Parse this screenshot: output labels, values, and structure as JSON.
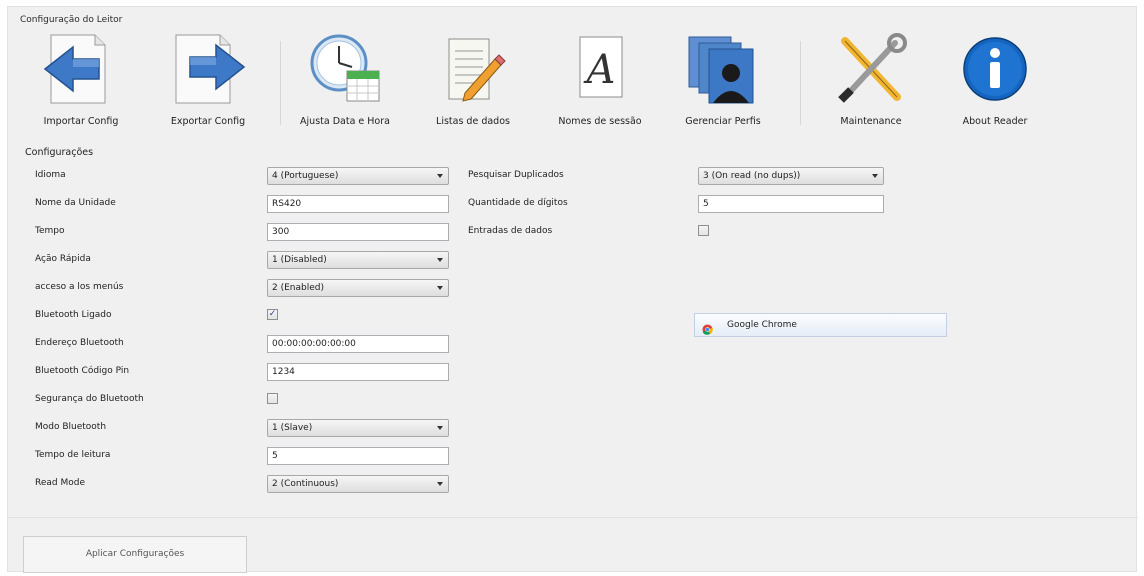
{
  "window": {
    "title": "Configuração do Leitor"
  },
  "toolbar": [
    {
      "label": "Importar Config",
      "icon": "import-arrow-icon"
    },
    {
      "label": "Exportar Config",
      "icon": "export-arrow-icon"
    },
    {
      "label": "Ajusta Data e Hora",
      "icon": "clock-calendar-icon"
    },
    {
      "label": "Listas de dados",
      "icon": "notepad-pencil-icon"
    },
    {
      "label": "Nomes de sessão",
      "icon": "font-letter-icon"
    },
    {
      "label": "Gerenciar Perfis",
      "icon": "profiles-icon"
    },
    {
      "label": "Maintenance",
      "icon": "tools-icon"
    },
    {
      "label": "About Reader",
      "icon": "info-icon"
    }
  ],
  "settings": {
    "title": "Configurações",
    "left": [
      {
        "label": "Idioma",
        "type": "combo",
        "value": "4 (Portuguese)"
      },
      {
        "label": "Nome da Unidade",
        "type": "text",
        "value": "RS420"
      },
      {
        "label": "Tempo",
        "type": "text",
        "value": "300"
      },
      {
        "label": "Ação Rápida",
        "type": "combo",
        "value": "1 (Disabled)"
      },
      {
        "label": "acceso a los menús",
        "type": "combo",
        "value": "2 (Enabled)"
      },
      {
        "label": "Bluetooth Ligado",
        "type": "check",
        "value": "true"
      },
      {
        "label": "Endereço Bluetooth",
        "type": "text",
        "value": "00:00:00:00:00:00"
      },
      {
        "label": "Bluetooth Código Pin",
        "type": "text",
        "value": "1234"
      },
      {
        "label": "Segurança do Bluetooth",
        "type": "check",
        "value": "false"
      },
      {
        "label": "Modo Bluetooth",
        "type": "combo",
        "value": "1 (Slave)"
      },
      {
        "label": "Tempo de leitura",
        "type": "text",
        "value": "5"
      },
      {
        "label": "Read Mode",
        "type": "combo",
        "value": "2 (Continuous)"
      }
    ],
    "right": [
      {
        "label": "Pesquisar Duplicados",
        "type": "combo",
        "value": "3 (On read (no dups))"
      },
      {
        "label": "Quantidade de dígitos",
        "type": "text",
        "value": "5"
      },
      {
        "label": "Entradas de dados",
        "type": "check",
        "value": "false"
      }
    ]
  },
  "taskbar_button": {
    "label": "Google Chrome",
    "icon": "chrome-icon"
  },
  "apply_button": {
    "label": "Aplicar Configurações"
  }
}
